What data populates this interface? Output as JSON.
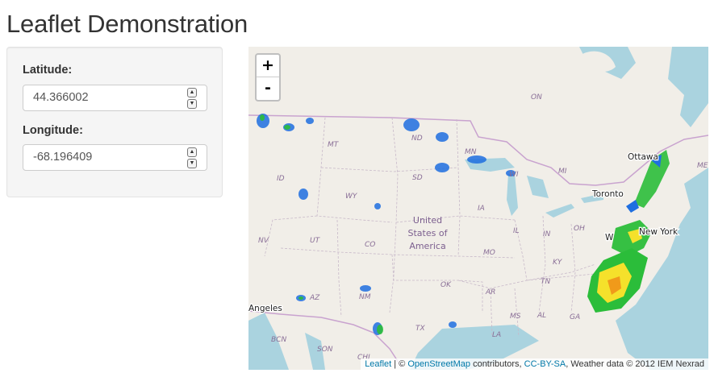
{
  "page": {
    "title": "Leaflet Demonstration"
  },
  "sidebar": {
    "latitude": {
      "label": "Latitude:",
      "value": "44.366002"
    },
    "longitude": {
      "label": "Longitude:",
      "value": "-68.196409"
    }
  },
  "map": {
    "zoom_in": "+",
    "zoom_out": "-",
    "country_label": [
      "United",
      "States of",
      "America"
    ],
    "state_labels": [
      "ON",
      "MT",
      "ND",
      "MN",
      "SD",
      "WI",
      "MI",
      "ID",
      "WY",
      "IA",
      "NV",
      "UT",
      "CO",
      "IL",
      "IN",
      "OH",
      "MO",
      "KY",
      "OK",
      "AR",
      "TN",
      "AZ",
      "NM",
      "MS",
      "AL",
      "GA",
      "TX",
      "LA",
      "BCN",
      "SON",
      "CHI",
      "ME"
    ],
    "city_labels": [
      "Ottawa",
      "Toronto",
      "New York",
      "Angeles",
      "W"
    ],
    "attribution": {
      "leaflet": "Leaflet",
      "sep1": " | © ",
      "osm": "OpenStreetMap",
      "contrib": " contributors, ",
      "license": "CC-BY-SA",
      "weather": ", Weather data © 2012 IEM Nexrad"
    }
  }
}
